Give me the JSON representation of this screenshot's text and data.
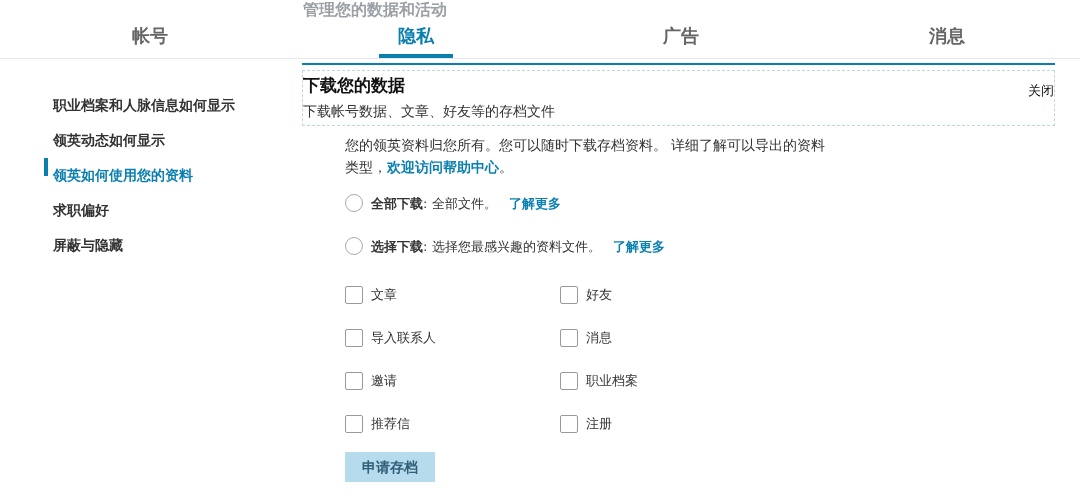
{
  "background_heading": "管理您的数据和活动",
  "tabs": [
    {
      "label": "帐号",
      "selected": false
    },
    {
      "label": "隐私",
      "selected": true
    },
    {
      "label": "广告",
      "selected": false
    },
    {
      "label": "消息",
      "selected": false
    }
  ],
  "sidebar": {
    "items": [
      {
        "label": "职业档案和人脉信息如何显示",
        "selected": false
      },
      {
        "label": "领英动态如何显示",
        "selected": false
      },
      {
        "label": "领英如何使用您的资料",
        "selected": true
      },
      {
        "label": "求职偏好",
        "selected": false
      },
      {
        "label": "屏蔽与隐藏",
        "selected": false
      }
    ]
  },
  "panel": {
    "title": "下载您的数据",
    "close": "关闭",
    "subtitle": "下载帐号数据、文章、好友等的存档文件"
  },
  "description": {
    "text": "您的领英资料归您所有。您可以随时下载存档资料。 详细了解可以导出的资料类型，",
    "link": "欢迎访问帮助中心",
    "end": "。"
  },
  "options": [
    {
      "label": "全部下载",
      "text": ": 全部文件。",
      "link": "了解更多",
      "selected": false
    },
    {
      "label": "选择下载",
      "text": ": 选择您最感兴趣的资料文件。",
      "link": "了解更多",
      "selected": false
    }
  ],
  "files": [
    {
      "label": "文章",
      "checked": false
    },
    {
      "label": "好友",
      "checked": false
    },
    {
      "label": "导入联系人",
      "checked": false
    },
    {
      "label": "消息",
      "checked": false
    },
    {
      "label": "邀请",
      "checked": false
    },
    {
      "label": "职业档案",
      "checked": false
    },
    {
      "label": "推荐信",
      "checked": false
    },
    {
      "label": "注册",
      "checked": false
    }
  ],
  "submit": {
    "label": "申请存档",
    "disabled": true
  }
}
